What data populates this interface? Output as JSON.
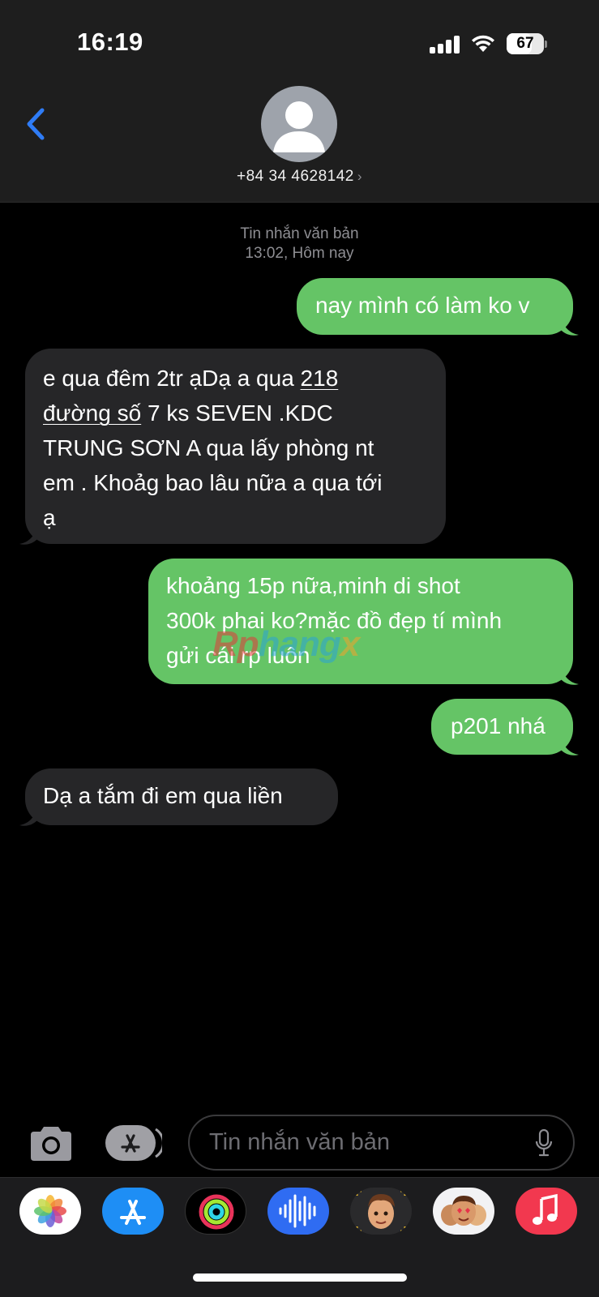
{
  "status_bar": {
    "time": "16:19",
    "battery_level": "67"
  },
  "header": {
    "contact_number": "+84 34 4628142",
    "back_icon": "chevron-left-icon",
    "avatar_icon": "person-silhouette-icon"
  },
  "conversation": {
    "timestamp_line1": "Tin nhắn văn bản",
    "timestamp_line2": "13:02, Hôm nay",
    "messages": [
      {
        "direction": "sent",
        "lines": [
          "nay mình có làm ko v"
        ]
      },
      {
        "direction": "received",
        "lines": [
          " e  qua đêm 2tr ạDạ a qua  ",
          "218",
          "đường số",
          " 7  ks SEVEN .KDC",
          "TRUNG SƠN  A qua lấy phòng nt",
          "em . Khoảg bao lâu nữa a qua tới",
          "ạ"
        ]
      },
      {
        "direction": "sent",
        "lines": [
          "khoảng 15p nữa,minh di shot",
          "300k phai ko?mặc đồ đẹp tí mình",
          "gửi cái rp luôn"
        ]
      },
      {
        "direction": "sent",
        "lines": [
          "p201 nhá"
        ]
      },
      {
        "direction": "received",
        "lines": [
          "Dạ a tắm đi em qua liền"
        ]
      }
    ]
  },
  "watermark": {
    "part1": "Rp",
    "part2": "hang",
    "part3": "x"
  },
  "input_bar": {
    "placeholder": "Tin nhắn văn bản",
    "camera_icon": "camera-icon",
    "apps_icon": "app-store-icon",
    "mic_icon": "microphone-icon"
  },
  "app_drawer": [
    {
      "name": "photos-app-icon"
    },
    {
      "name": "app-store-app-icon"
    },
    {
      "name": "fitness-activity-app-icon"
    },
    {
      "name": "audio-message-app-icon"
    },
    {
      "name": "memoji-app-icon"
    },
    {
      "name": "memoji-stickers-app-icon"
    },
    {
      "name": "music-app-icon"
    }
  ],
  "colors": {
    "sent_bubble": "#65c466",
    "received_bubble": "#262628",
    "accent_blue": "#2f7cf6"
  }
}
